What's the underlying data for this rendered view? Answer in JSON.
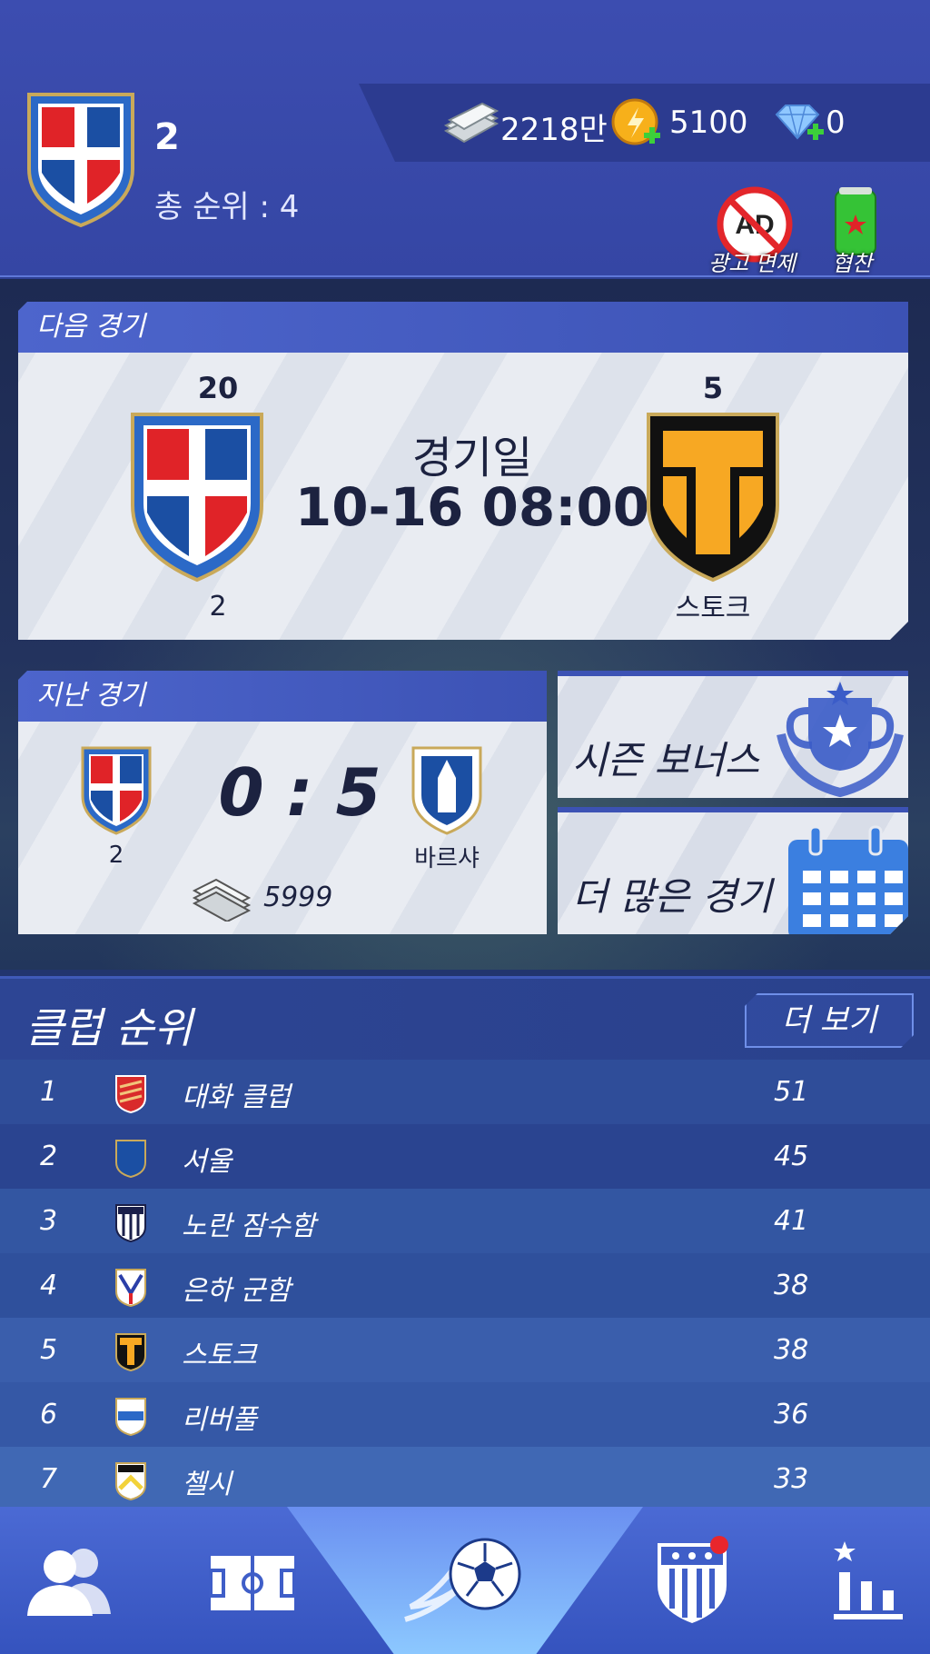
{
  "header": {
    "club_name": "2",
    "overall_rank": "총 순위 : 4",
    "cash": "2218만",
    "coins": "5100",
    "gems": "0",
    "ad_free_label": "광고 면제",
    "sponsor_label": "협찬"
  },
  "next_match": {
    "title": "다음 경기",
    "home_rank": "20",
    "home_name": "2",
    "match_day_label": "경기일",
    "datetime": "10-16 08:00",
    "away_rank": "5",
    "away_name": "스토크"
  },
  "last_match": {
    "title": "지난 경기",
    "home_name": "2",
    "score": "0 : 5",
    "away_name": "바르샤",
    "reward": "5999"
  },
  "side_buttons": {
    "season_bonus": "시즌 보너스",
    "more_matches": "더 많은 경기"
  },
  "standings": {
    "title": "클럽 순위",
    "more_label": "더 보기",
    "rows": [
      {
        "rank": "1",
        "name": "대화 클럽",
        "points": "51"
      },
      {
        "rank": "2",
        "name": "서울",
        "points": "45"
      },
      {
        "rank": "3",
        "name": "노란 잠수함",
        "points": "41"
      },
      {
        "rank": "4",
        "name": "은하 군함",
        "points": "38"
      },
      {
        "rank": "5",
        "name": "스토크",
        "points": "38"
      },
      {
        "rank": "6",
        "name": "리버풀",
        "points": "36"
      },
      {
        "rank": "7",
        "name": "첼시",
        "points": "33"
      }
    ]
  },
  "bottom_nav": {
    "items": [
      "players-icon",
      "tactics-field-icon",
      "match-ball-icon",
      "club-badge-icon",
      "rankings-icon"
    ]
  },
  "colors": {
    "header_bg": "#3546a4",
    "row_odd": "#2f4d99",
    "row_even": "#2a4490",
    "accent_red": "#e8262c",
    "accent_orange": "#f7a823"
  }
}
